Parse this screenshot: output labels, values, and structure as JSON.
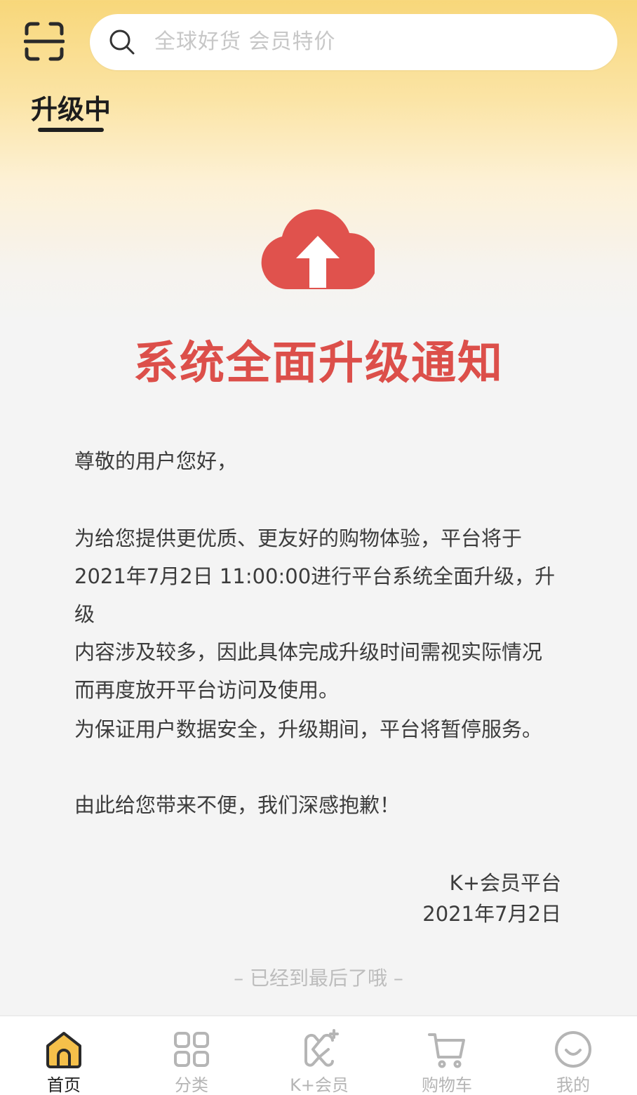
{
  "header": {
    "search_placeholder": "全球好货 会员特价",
    "active_tab": "升级中"
  },
  "notice": {
    "title": "系统全面升级通知",
    "greeting": "尊敬的用户您好，",
    "body_lines": [
      "为给您提供更优质、更友好的购物体验，平台将于",
      "2021年7月2日 11:00:00进行平台系统全面升级，升级",
      "内容涉及较多，因此具体完成升级时间需视实际情况",
      "而再度放开平台访问及使用。"
    ],
    "safety": "为保证用户数据安全，升级期间，平台将暂停服务。",
    "apology": "由此给您带来不便，我们深感抱歉！",
    "signature_name": "K+会员平台",
    "signature_date": "2021年7月2日"
  },
  "footer_end": "– 已经到最后了哦 –",
  "bottom_nav": {
    "items": [
      {
        "label": "首页",
        "icon": "home-icon",
        "active": true
      },
      {
        "label": "分类",
        "icon": "grid-icon",
        "active": false
      },
      {
        "label": "K+会员",
        "icon": "k-plus-icon",
        "active": false
      },
      {
        "label": "购物车",
        "icon": "cart-icon",
        "active": false
      },
      {
        "label": "我的",
        "icon": "smile-icon",
        "active": false
      }
    ]
  },
  "colors": {
    "accent_red": "#dc4f4a",
    "header_gold": "#f8d77a",
    "active_icon_fill": "#f5c04a"
  }
}
